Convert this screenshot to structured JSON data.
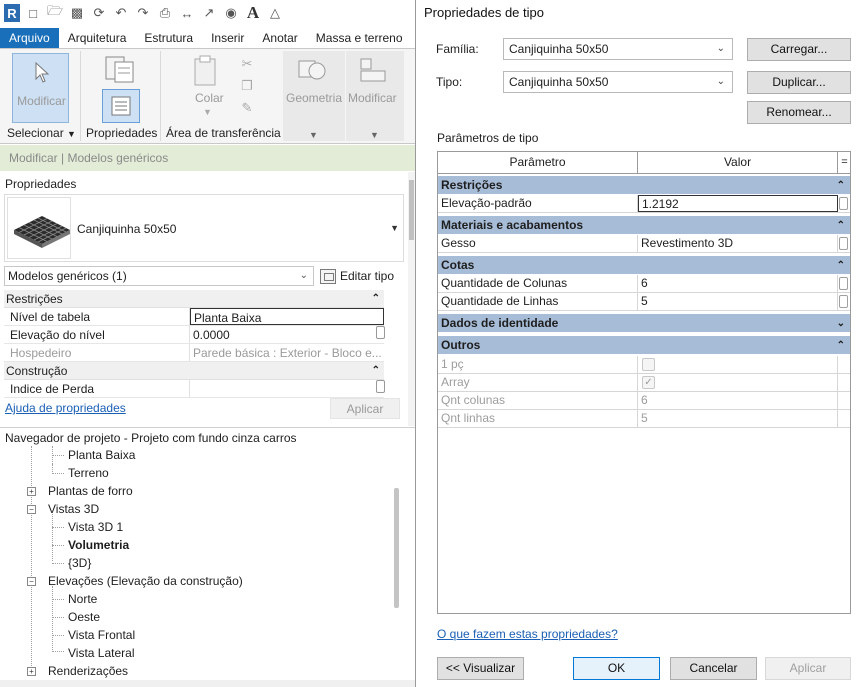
{
  "left": {
    "qat_letter_icon": "A",
    "ribbon_tabs": [
      "Arquivo",
      "Arquitetura",
      "Estrutura",
      "Inserir",
      "Anotar",
      "Massa e terreno"
    ],
    "ribbon": {
      "modificar_big": "Modificar",
      "selecionar": "Selecionar",
      "propriedades": "Propriedades",
      "colar": "Colar",
      "area_transferencia": "Área de transferência",
      "geometria": "Geometria",
      "modificar_panel": "Modificar"
    },
    "context_bar": "Modificar | Modelos genéricos",
    "properties": {
      "title": "Propriedades",
      "type_name": "Canjiquinha 50x50",
      "instance_selector": "Modelos genéricos (1)",
      "edit_type": "Editar tipo",
      "groups": [
        {
          "name": "Restrições",
          "rows": [
            {
              "name": "Nível de tabela",
              "value": "Planta Baixa"
            },
            {
              "name": "Elevação do nível",
              "value": "0.0000"
            },
            {
              "name": "Hospedeiro",
              "value": "Parede básica : Exterior - Bloco e..."
            }
          ]
        },
        {
          "name": "Construção",
          "rows": [
            {
              "name": "Indice de Perda",
              "value": ""
            }
          ]
        }
      ],
      "help_link": "Ajuda de propriedades",
      "apply": "Aplicar"
    },
    "browser": {
      "title": "Navegador de projeto - Projeto com fundo cinza carros",
      "items": [
        {
          "label": "Planta Baixa",
          "bold": false
        },
        {
          "label": "Terreno",
          "bold": false
        },
        {
          "label": "Plantas de forro",
          "bold": false
        },
        {
          "label": "Vistas 3D",
          "bold": false
        },
        {
          "label": "Vista 3D 1",
          "bold": false
        },
        {
          "label": "Volumetria",
          "bold": true
        },
        {
          "label": "{3D}",
          "bold": false
        },
        {
          "label": "Elevações (Elevação da construção)",
          "bold": false
        },
        {
          "label": "Norte",
          "bold": false
        },
        {
          "label": "Oeste",
          "bold": false
        },
        {
          "label": "Vista Frontal",
          "bold": false
        },
        {
          "label": "Vista Lateral",
          "bold": false
        },
        {
          "label": "Renderizações",
          "bold": false
        }
      ]
    }
  },
  "dialog": {
    "title": "Propriedades de tipo",
    "familia_label": "Família:",
    "familia_value": "Canjiquinha 50x50",
    "tipo_label": "Tipo:",
    "tipo_value": "Canjiquinha 50x50",
    "btn_carregar": "Carregar...",
    "btn_duplicar": "Duplicar...",
    "btn_renomear": "Renomear...",
    "section_label": "Parâmetros de tipo",
    "col_param": "Parâmetro",
    "col_valor": "Valor",
    "col_eq": "=",
    "groups": [
      {
        "name": "Restrições",
        "rows": [
          {
            "name": "Elevação-padrão",
            "value": "1.2192"
          }
        ]
      },
      {
        "name": "Materiais e acabamentos",
        "rows": [
          {
            "name": "Gesso",
            "value": "Revestimento 3D"
          }
        ]
      },
      {
        "name": "Cotas",
        "rows": [
          {
            "name": "Quantidade de Colunas",
            "value": "6"
          },
          {
            "name": "Quantidade de Linhas",
            "value": "5"
          }
        ]
      },
      {
        "name": "Dados de identidade",
        "rows": []
      },
      {
        "name": "Outros",
        "rows": [
          {
            "name": "1 pç",
            "value": ""
          },
          {
            "name": "Array",
            "value": ""
          },
          {
            "name": "Qnt colunas",
            "value": "6"
          },
          {
            "name": "Qnt linhas",
            "value": "5"
          }
        ]
      }
    ],
    "help_link": "O que fazem estas propriedades?",
    "btn_preview": "<< Visualizar",
    "btn_ok": "OK",
    "btn_cancel": "Cancelar",
    "btn_apply": "Aplicar",
    "colors": {
      "group_header": "#a7bcd7",
      "active_tab": "#1a6fbb",
      "context_bar": "#e2ecd6"
    }
  }
}
